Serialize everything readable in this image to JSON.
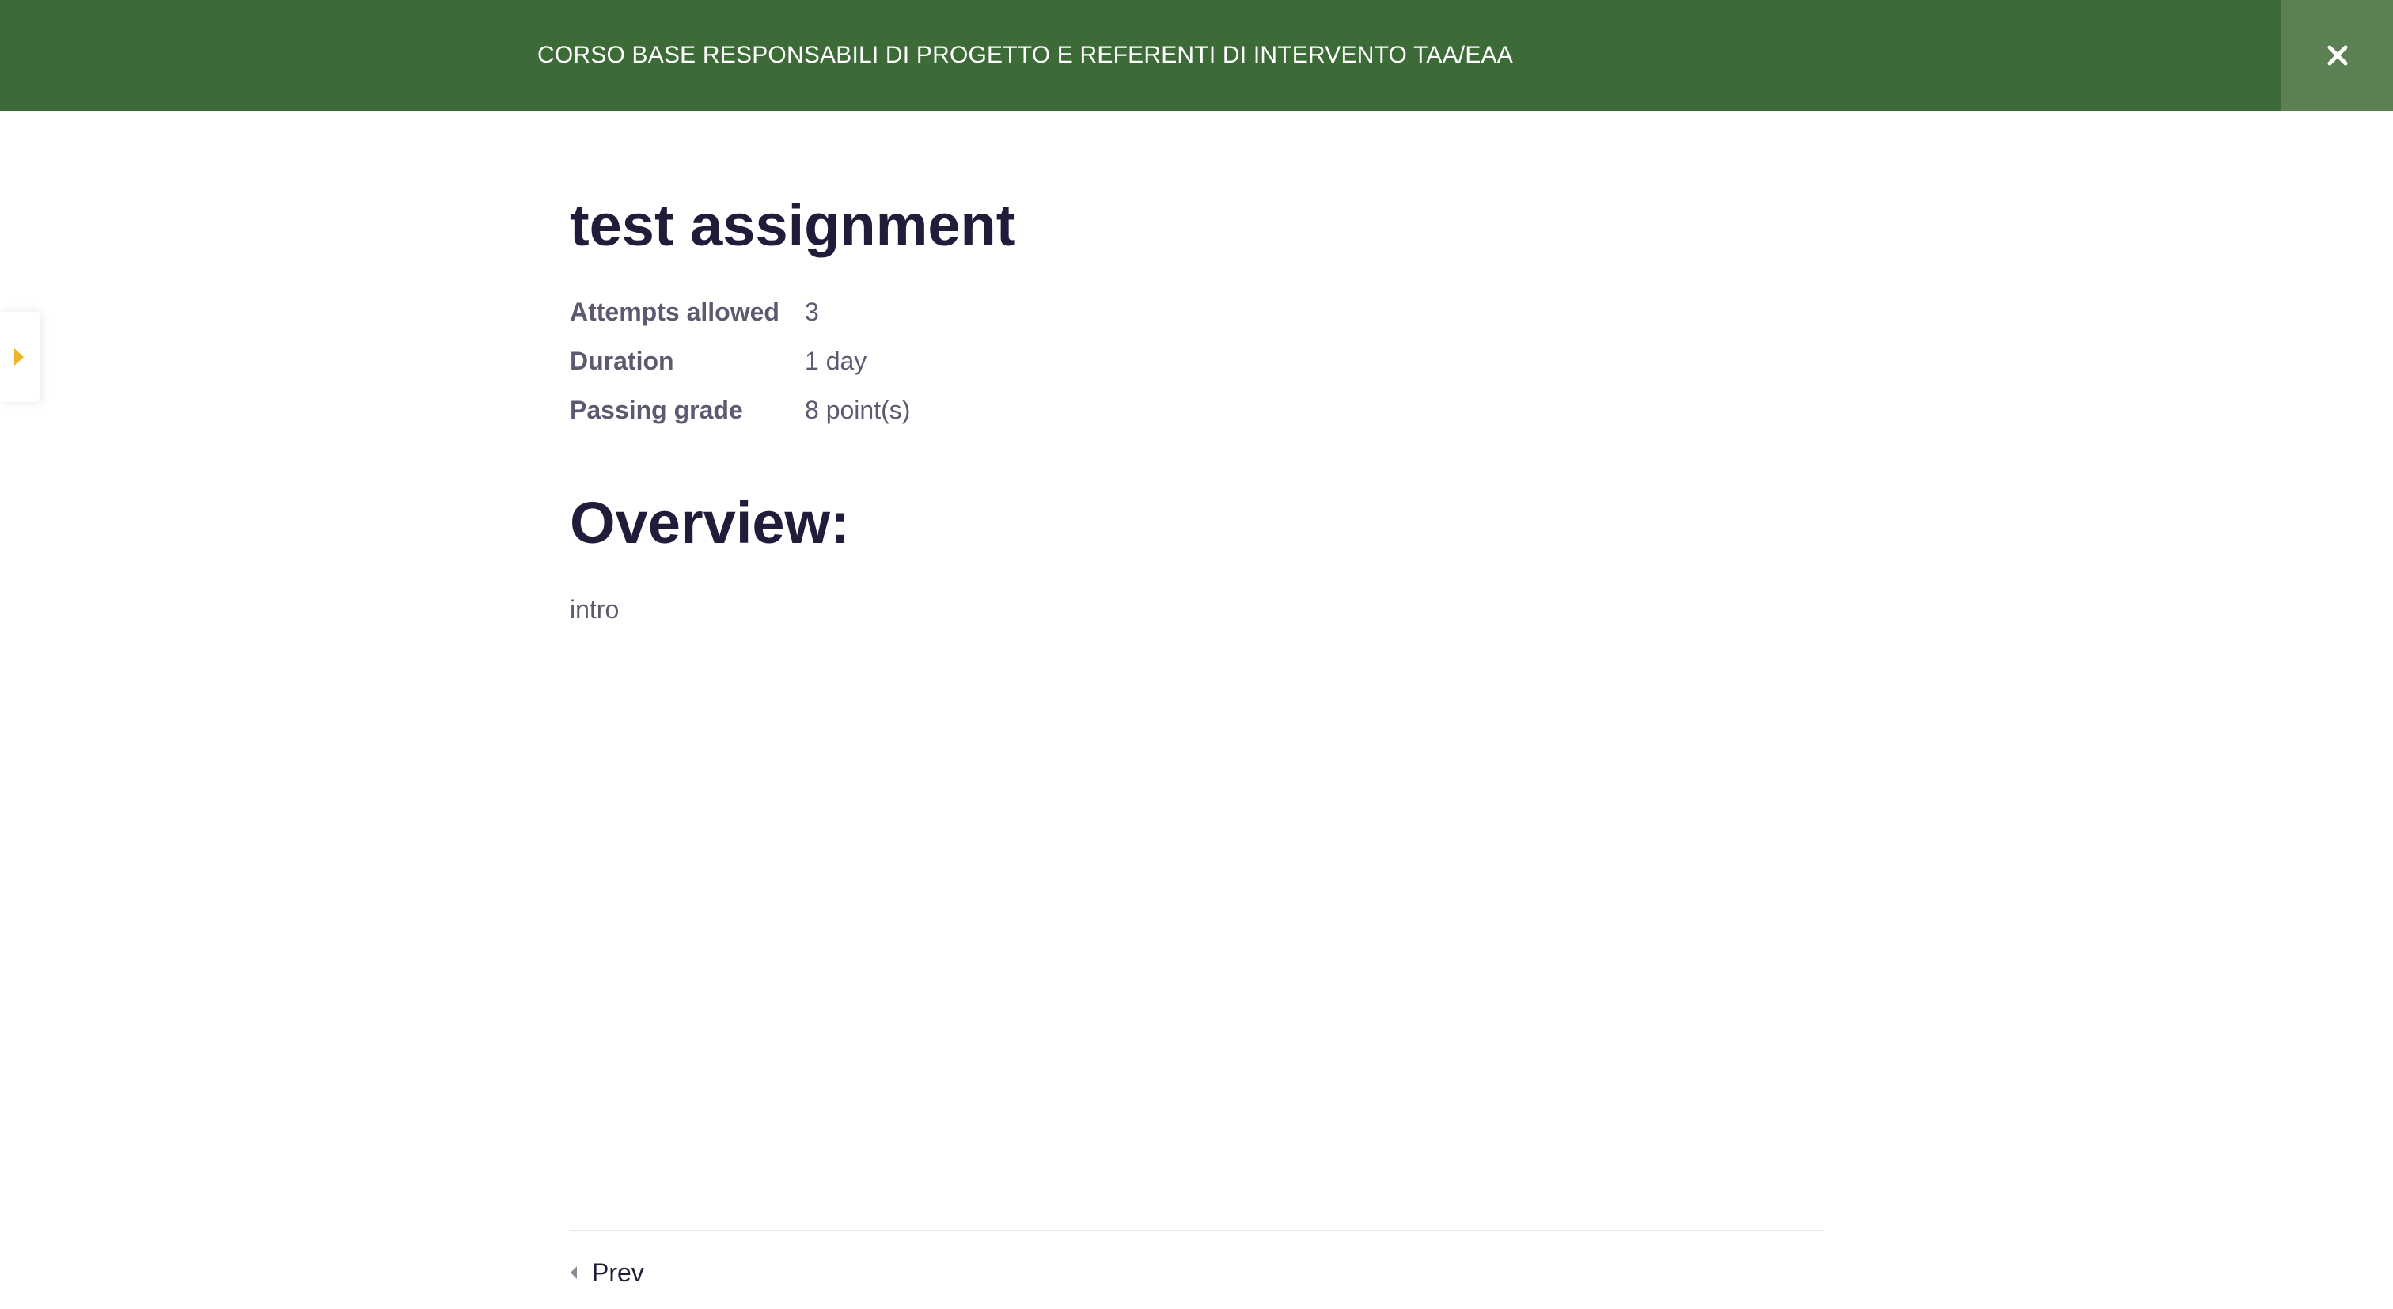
{
  "header": {
    "title": "CORSO BASE RESPONSABILI DI PROGETTO E REFERENTI DI INTERVENTO TAA/EAA",
    "close_icon": "close-icon",
    "background_color": "#3d6b37"
  },
  "sidebar_toggle": {
    "icon": "caret-right-icon",
    "icon_color": "#f0b429"
  },
  "lesson": {
    "title": "test assignment",
    "meta": [
      {
        "label": "Attempts allowed",
        "value": "3"
      },
      {
        "label": "Duration",
        "value": "1 day"
      },
      {
        "label": "Passing grade",
        "value": "8 point(s)"
      }
    ],
    "overview_heading": "Overview:",
    "overview_text": "intro"
  },
  "navigation": {
    "prev_label": "Prev",
    "prev_icon": "caret-left-icon"
  }
}
